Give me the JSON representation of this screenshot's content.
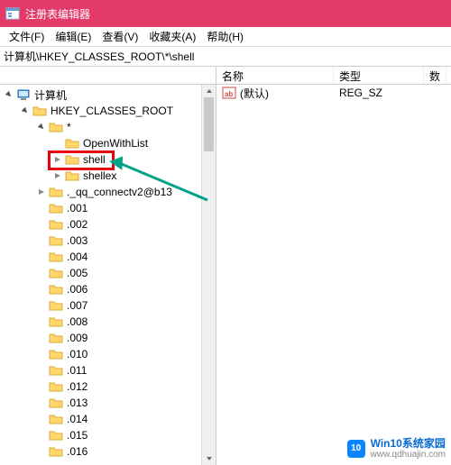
{
  "title": "注册表编辑器",
  "menus": {
    "file": "文件(F)",
    "edit": "编辑(E)",
    "view": "查看(V)",
    "favorites": "收藏夹(A)",
    "help": "帮助(H)"
  },
  "address": "计算机\\HKEY_CLASSES_ROOT\\*\\shell",
  "tree": {
    "root": "计算机",
    "hkcr": "HKEY_CLASSES_ROOT",
    "star": "*",
    "openWithList": "OpenWithList",
    "shell": "shell",
    "shellex": "shellex",
    "qqconnect": "._qq_connectv2@b13",
    "numbered": [
      ".001",
      ".002",
      ".003",
      ".004",
      ".005",
      ".006",
      ".007",
      ".008",
      ".009",
      ".010",
      ".011",
      ".012",
      ".013",
      ".014",
      ".015",
      ".016"
    ]
  },
  "list": {
    "cols": {
      "name": "名称",
      "type": "类型",
      "data": "数"
    },
    "rows": [
      {
        "name": "(默认)",
        "type": "REG_SZ"
      }
    ]
  },
  "watermark": {
    "badge": "10",
    "main": "Win10系统家园",
    "sub": "www.qdhuajin.com"
  }
}
